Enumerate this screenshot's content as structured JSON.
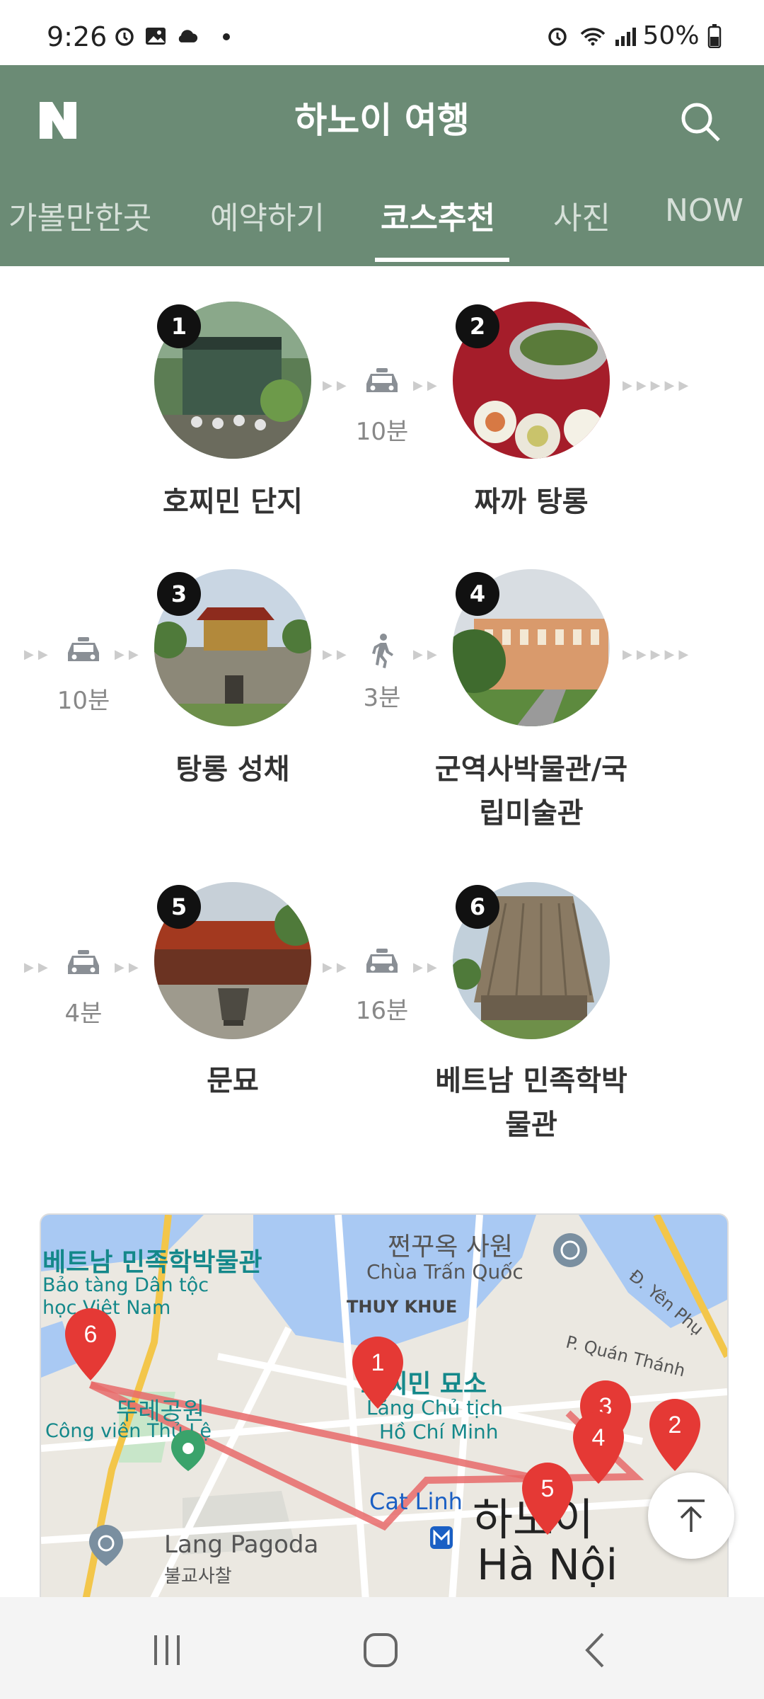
{
  "status_bar": {
    "time": "9:26",
    "battery": "50%"
  },
  "header": {
    "title": "하노이 여행",
    "logo": "N"
  },
  "tabs": [
    {
      "label": "가볼만한곳",
      "active": false
    },
    {
      "label": "예약하기",
      "active": false
    },
    {
      "label": "코스추천",
      "active": true
    },
    {
      "label": "사진",
      "active": false
    },
    {
      "label": "NOW",
      "active": false
    }
  ],
  "course": [
    {
      "num": "1",
      "name": "호찌민 단지"
    },
    {
      "num": "2",
      "name": "짜까 탕롱"
    },
    {
      "num": "3",
      "name": "탕롱 성채"
    },
    {
      "num": "4",
      "name": "군역사박물관/국\n립미술관"
    },
    {
      "num": "5",
      "name": "문묘"
    },
    {
      "num": "6",
      "name": "베트남 민족학박\n물관"
    }
  ],
  "connectors": [
    {
      "mode": "taxi",
      "time": "10분"
    },
    {
      "mode": "taxi",
      "time": "10분"
    },
    {
      "mode": "walk",
      "time": "3분"
    },
    {
      "mode": "taxi",
      "time": "4분"
    },
    {
      "mode": "taxi",
      "time": "16분"
    }
  ],
  "map": {
    "labels": {
      "museum_ko": "베트남 민족학박물관",
      "museum_vi1": "Bảo tàng Dân tộc",
      "museum_vi2": "học Việt Nam",
      "pagoda_ko": "쩐꾸옥 사원",
      "pagoda_vi": "Chùa Trấn Quốc",
      "thuy_khue": "THUY KHUE",
      "yen_phu": "Đ. Yên Phụ",
      "quan_thanh": "P. Quán Thánh",
      "hcm_ko": "호찌민 묘소",
      "hcm_vi1": "Lăng Chủ tịch",
      "hcm_vi2": "Hồ Chí Minh",
      "park_ko": "뚜레공원",
      "park_vi": "Công viên Thủ Lệ",
      "cat_linh": "Cat Linh",
      "hanoi_ko": "하노이",
      "hanoi_vi": "Hà Nội",
      "lang_pagoda": "Lang Pagoda",
      "lang_pagoda_ko": "불교사찰"
    },
    "pins": [
      "6",
      "1",
      "3",
      "4",
      "2",
      "5"
    ]
  }
}
